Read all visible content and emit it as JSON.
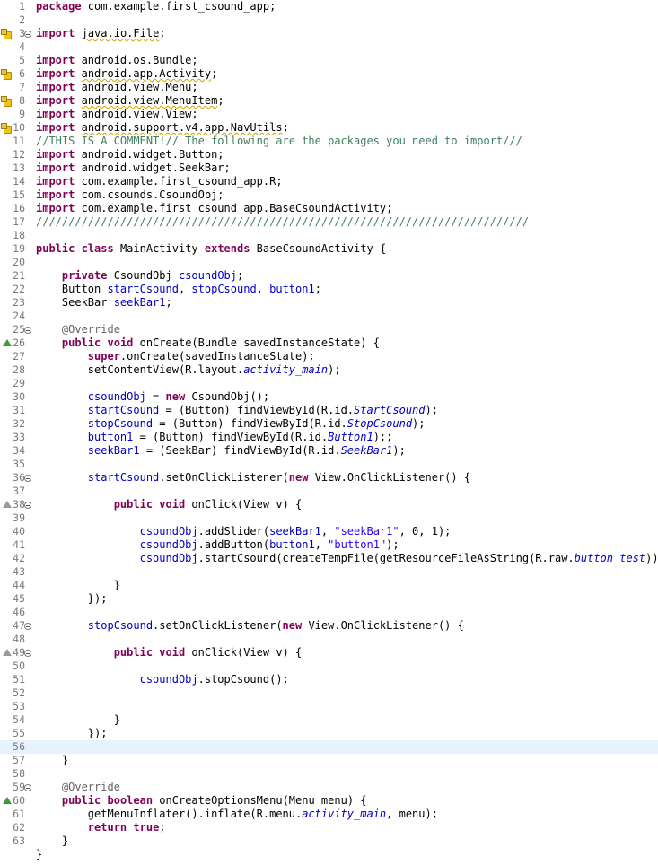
{
  "editor": {
    "current_line": 56,
    "lines": [
      {
        "n": 1,
        "tokens": [
          {
            "t": "package",
            "c": "kw"
          },
          {
            "t": " com.example.first_csound_app;"
          }
        ]
      },
      {
        "n": 2,
        "tokens": []
      },
      {
        "n": 3,
        "fold": true,
        "marker": "warning",
        "tokens": [
          {
            "t": "import",
            "c": "kw"
          },
          {
            "t": " "
          },
          {
            "t": "java.io.File",
            "c": "sq"
          },
          {
            "t": ";"
          }
        ]
      },
      {
        "n": 4,
        "tokens": []
      },
      {
        "n": 5,
        "tokens": [
          {
            "t": "import",
            "c": "kw"
          },
          {
            "t": " android.os.Bundle;"
          }
        ]
      },
      {
        "n": 6,
        "marker": "warning",
        "tokens": [
          {
            "t": "import",
            "c": "kw"
          },
          {
            "t": " "
          },
          {
            "t": "android.app.Activity",
            "c": "sq"
          },
          {
            "t": ";"
          }
        ]
      },
      {
        "n": 7,
        "tokens": [
          {
            "t": "import",
            "c": "kw"
          },
          {
            "t": " android.view.Menu;"
          }
        ]
      },
      {
        "n": 8,
        "marker": "warning",
        "tokens": [
          {
            "t": "import",
            "c": "kw"
          },
          {
            "t": " "
          },
          {
            "t": "android.view.MenuItem",
            "c": "sq"
          },
          {
            "t": ";"
          }
        ]
      },
      {
        "n": 9,
        "tokens": [
          {
            "t": "import",
            "c": "kw"
          },
          {
            "t": " android.view.View;"
          }
        ]
      },
      {
        "n": 10,
        "marker": "warning",
        "tokens": [
          {
            "t": "import",
            "c": "kw"
          },
          {
            "t": " "
          },
          {
            "t": "android.support.v4.app.NavUtils",
            "c": "sq"
          },
          {
            "t": ";"
          }
        ]
      },
      {
        "n": 11,
        "tokens": [
          {
            "t": "//THIS IS A COMMENT!// The following are the packages you need to import///",
            "c": "cm"
          }
        ]
      },
      {
        "n": 12,
        "tokens": [
          {
            "t": "import",
            "c": "kw"
          },
          {
            "t": " android.widget.Button;"
          }
        ]
      },
      {
        "n": 13,
        "tokens": [
          {
            "t": "import",
            "c": "kw"
          },
          {
            "t": " android.widget.SeekBar;"
          }
        ]
      },
      {
        "n": 14,
        "tokens": [
          {
            "t": "import",
            "c": "kw"
          },
          {
            "t": " com.example.first_csound_app.R;"
          }
        ]
      },
      {
        "n": 15,
        "tokens": [
          {
            "t": "import",
            "c": "kw"
          },
          {
            "t": " com.csounds.CsoundObj;"
          }
        ]
      },
      {
        "n": 16,
        "tokens": [
          {
            "t": "import",
            "c": "kw"
          },
          {
            "t": " com.example.first_csound_app.BaseCsoundActivity;"
          }
        ]
      },
      {
        "n": 17,
        "tokens": [
          {
            "t": "////////////////////////////////////////////////////////////////////////////",
            "c": "cm"
          }
        ]
      },
      {
        "n": 18,
        "tokens": []
      },
      {
        "n": 19,
        "tokens": [
          {
            "t": "public",
            "c": "kw"
          },
          {
            "t": " "
          },
          {
            "t": "class",
            "c": "kw"
          },
          {
            "t": " MainActivity "
          },
          {
            "t": "extends",
            "c": "kw"
          },
          {
            "t": " BaseCsoundActivity {"
          }
        ]
      },
      {
        "n": 20,
        "tokens": []
      },
      {
        "n": 21,
        "tokens": [
          {
            "t": "    "
          },
          {
            "t": "private",
            "c": "kw"
          },
          {
            "t": " CsoundObj "
          },
          {
            "t": "csoundObj",
            "c": "fld"
          },
          {
            "t": ";"
          }
        ]
      },
      {
        "n": 22,
        "tokens": [
          {
            "t": "    Button "
          },
          {
            "t": "startCsound",
            "c": "fld"
          },
          {
            "t": ", "
          },
          {
            "t": "stopCsound",
            "c": "fld"
          },
          {
            "t": ", "
          },
          {
            "t": "button1",
            "c": "fld"
          },
          {
            "t": ";"
          }
        ]
      },
      {
        "n": 23,
        "tokens": [
          {
            "t": "    SeekBar "
          },
          {
            "t": "seekBar1",
            "c": "fld"
          },
          {
            "t": ";"
          }
        ]
      },
      {
        "n": 24,
        "tokens": []
      },
      {
        "n": 25,
        "fold": true,
        "tokens": [
          {
            "t": "    "
          },
          {
            "t": "@Override",
            "c": "an"
          }
        ]
      },
      {
        "n": 26,
        "marker": "override",
        "tokens": [
          {
            "t": "    "
          },
          {
            "t": "public",
            "c": "kw"
          },
          {
            "t": " "
          },
          {
            "t": "void",
            "c": "kw"
          },
          {
            "t": " onCreate(Bundle savedInstanceState) {"
          }
        ]
      },
      {
        "n": 27,
        "tokens": [
          {
            "t": "        "
          },
          {
            "t": "super",
            "c": "kw"
          },
          {
            "t": ".onCreate(savedInstanceState);"
          }
        ]
      },
      {
        "n": 28,
        "tokens": [
          {
            "t": "        setContentView(R.layout."
          },
          {
            "t": "activity_main",
            "c": "sfld"
          },
          {
            "t": ");"
          }
        ]
      },
      {
        "n": 29,
        "tokens": []
      },
      {
        "n": 30,
        "tokens": [
          {
            "t": "        "
          },
          {
            "t": "csoundObj",
            "c": "fld"
          },
          {
            "t": " = "
          },
          {
            "t": "new",
            "c": "kw"
          },
          {
            "t": " CsoundObj();"
          }
        ]
      },
      {
        "n": 31,
        "tokens": [
          {
            "t": "        "
          },
          {
            "t": "startCsound",
            "c": "fld"
          },
          {
            "t": " = (Button) findViewById(R.id."
          },
          {
            "t": "StartCsound",
            "c": "sfld"
          },
          {
            "t": ");"
          }
        ]
      },
      {
        "n": 32,
        "tokens": [
          {
            "t": "        "
          },
          {
            "t": "stopCsound",
            "c": "fld"
          },
          {
            "t": " = (Button) findViewById(R.id."
          },
          {
            "t": "StopCsound",
            "c": "sfld"
          },
          {
            "t": ");"
          }
        ]
      },
      {
        "n": 33,
        "tokens": [
          {
            "t": "        "
          },
          {
            "t": "button1",
            "c": "fld"
          },
          {
            "t": " = (Button) findViewById(R.id."
          },
          {
            "t": "Button1",
            "c": "sfld"
          },
          {
            "t": ");;"
          }
        ]
      },
      {
        "n": 34,
        "tokens": [
          {
            "t": "        "
          },
          {
            "t": "seekBar1",
            "c": "fld"
          },
          {
            "t": " = (SeekBar) findViewById(R.id."
          },
          {
            "t": "SeekBar1",
            "c": "sfld"
          },
          {
            "t": ");"
          }
        ]
      },
      {
        "n": 35,
        "tokens": []
      },
      {
        "n": 36,
        "fold": true,
        "tokens": [
          {
            "t": "        "
          },
          {
            "t": "startCsound",
            "c": "fld"
          },
          {
            "t": ".setOnClickListener("
          },
          {
            "t": "new",
            "c": "kw"
          },
          {
            "t": " View.OnClickListener() {"
          }
        ]
      },
      {
        "n": 37,
        "tokens": []
      },
      {
        "n": 38,
        "fold": true,
        "marker": "override-hollow",
        "tokens": [
          {
            "t": "            "
          },
          {
            "t": "public",
            "c": "kw"
          },
          {
            "t": " "
          },
          {
            "t": "void",
            "c": "kw"
          },
          {
            "t": " onClick(View v) {"
          }
        ]
      },
      {
        "n": 39,
        "tokens": []
      },
      {
        "n": 40,
        "tokens": [
          {
            "t": "                "
          },
          {
            "t": "csoundObj",
            "c": "fld"
          },
          {
            "t": ".addSlider("
          },
          {
            "t": "seekBar1",
            "c": "fld"
          },
          {
            "t": ", "
          },
          {
            "t": "\"seekBar1\"",
            "c": "st"
          },
          {
            "t": ", 0, 1);"
          }
        ]
      },
      {
        "n": 41,
        "tokens": [
          {
            "t": "                "
          },
          {
            "t": "csoundObj",
            "c": "fld"
          },
          {
            "t": ".addButton("
          },
          {
            "t": "button1",
            "c": "fld"
          },
          {
            "t": ", "
          },
          {
            "t": "\"button1\"",
            "c": "st"
          },
          {
            "t": ");"
          }
        ]
      },
      {
        "n": 42,
        "tokens": [
          {
            "t": "                "
          },
          {
            "t": "csoundObj",
            "c": "fld"
          },
          {
            "t": ".startCsound(createTempFile(getResourceFileAsString(R.raw."
          },
          {
            "t": "button_test",
            "c": "sfld"
          },
          {
            "t": ")));"
          }
        ]
      },
      {
        "n": 43,
        "tokens": []
      },
      {
        "n": 44,
        "tokens": [
          {
            "t": "            }"
          }
        ]
      },
      {
        "n": 45,
        "tokens": [
          {
            "t": "        });"
          }
        ]
      },
      {
        "n": 46,
        "tokens": []
      },
      {
        "n": 47,
        "fold": true,
        "tokens": [
          {
            "t": "        "
          },
          {
            "t": "stopCsound",
            "c": "fld"
          },
          {
            "t": ".setOnClickListener("
          },
          {
            "t": "new",
            "c": "kw"
          },
          {
            "t": " View.OnClickListener() {"
          }
        ]
      },
      {
        "n": 48,
        "tokens": []
      },
      {
        "n": 49,
        "fold": true,
        "marker": "override-hollow",
        "tokens": [
          {
            "t": "            "
          },
          {
            "t": "public",
            "c": "kw"
          },
          {
            "t": " "
          },
          {
            "t": "void",
            "c": "kw"
          },
          {
            "t": " onClick(View v) {"
          }
        ]
      },
      {
        "n": 50,
        "tokens": []
      },
      {
        "n": 51,
        "tokens": [
          {
            "t": "                "
          },
          {
            "t": "csoundObj",
            "c": "fld"
          },
          {
            "t": ".stopCsound();"
          }
        ]
      },
      {
        "n": 52,
        "tokens": []
      },
      {
        "n": 53,
        "tokens": []
      },
      {
        "n": 54,
        "tokens": [
          {
            "t": "            }"
          }
        ]
      },
      {
        "n": 55,
        "tokens": [
          {
            "t": "        });"
          }
        ]
      },
      {
        "n": 56,
        "tokens": []
      },
      {
        "n": 57,
        "tokens": [
          {
            "t": "    }"
          }
        ]
      },
      {
        "n": 58,
        "tokens": []
      },
      {
        "n": 59,
        "fold": true,
        "tokens": [
          {
            "t": "    "
          },
          {
            "t": "@Override",
            "c": "an"
          }
        ]
      },
      {
        "n": 60,
        "marker": "override",
        "tokens": [
          {
            "t": "    "
          },
          {
            "t": "public",
            "c": "kw"
          },
          {
            "t": " "
          },
          {
            "t": "boolean",
            "c": "kw"
          },
          {
            "t": " onCreateOptionsMenu(Menu menu) {"
          }
        ]
      },
      {
        "n": 61,
        "tokens": [
          {
            "t": "        getMenuInflater().inflate(R.menu."
          },
          {
            "t": "activity_main",
            "c": "sfld"
          },
          {
            "t": ", menu);"
          }
        ]
      },
      {
        "n": 62,
        "tokens": [
          {
            "t": "        "
          },
          {
            "t": "return",
            "c": "kw"
          },
          {
            "t": " "
          },
          {
            "t": "true",
            "c": "kw"
          },
          {
            "t": ";"
          }
        ]
      },
      {
        "n": 63,
        "tokens": [
          {
            "t": "    }"
          }
        ]
      },
      {
        "n": "",
        "tokens": [
          {
            "t": "}"
          }
        ]
      }
    ]
  }
}
